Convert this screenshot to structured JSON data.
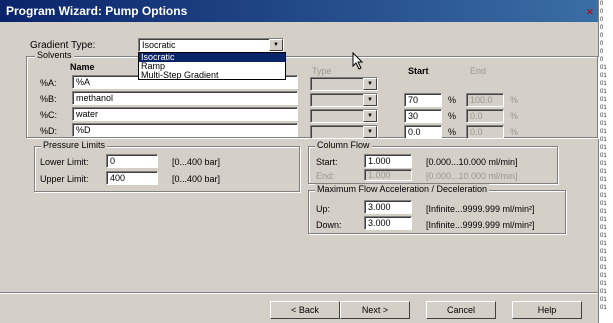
{
  "window": {
    "title": "Program Wizard: Pump Options"
  },
  "gradient": {
    "label": "Gradient Type:",
    "value": "Isocratic",
    "options": [
      "Isocratic",
      "Ramp",
      "Multi-Step Gradient"
    ]
  },
  "solvents": {
    "legend": "Solvents",
    "col_name": "Name",
    "col_type": "Type",
    "col_start": "Start",
    "col_end": "End",
    "percent_sign": "%",
    "rows": [
      {
        "label": "%A:",
        "name": "%A",
        "start": "",
        "end": ""
      },
      {
        "label": "%B:",
        "name": "methanol",
        "start": "70",
        "end": "100.0"
      },
      {
        "label": "%C:",
        "name": "water",
        "start": "30",
        "end": "0.0"
      },
      {
        "label": "%D:",
        "name": "%D",
        "start": "0.0",
        "end": "0.0"
      }
    ]
  },
  "pressure": {
    "legend": "Pressure Limits",
    "lower_label": "Lower Limit:",
    "lower_value": "0",
    "lower_range": "[0...400 bar]",
    "upper_label": "Upper Limit:",
    "upper_value": "400",
    "upper_range": "[0...400 bar]"
  },
  "column_flow": {
    "legend": "Column Flow",
    "start_label": "Start:",
    "start_value": "1.000",
    "start_range": "[0.000...10.000 ml/min]",
    "end_label": "End:",
    "end_value": "1.000",
    "end_range": "[0.000...10.000 ml/min]"
  },
  "max_flow": {
    "legend": "Maximum Flow Acceleration / Deceleration",
    "up_label": "Up:",
    "up_value": "3.000",
    "up_range": "[Infinite...9999.999 ml/min²]",
    "down_label": "Down:",
    "down_value": "3.000",
    "down_range": "[Infinite...9999.999 ml/min²]"
  },
  "buttons": {
    "back": "< Back",
    "next": "Next >",
    "cancel": "Cancel",
    "help": "Help"
  },
  "close_glyph": "×",
  "background_fragments": [
    "0",
    "0",
    "0",
    "0",
    "0",
    "0",
    "0",
    "0",
    "01",
    "01",
    "01",
    "01",
    "01",
    "01",
    "01",
    "01",
    "01",
    "01",
    "01",
    "01",
    "01",
    "01",
    "01",
    "01",
    "01",
    "01",
    "01",
    "01",
    "01",
    "01",
    "01",
    "01",
    "01",
    "01",
    "01",
    "01",
    "01",
    "01",
    "01"
  ],
  "colors": {
    "titlebar": "#0a246a",
    "face": "#d4d0c8",
    "selection": "#0a246a"
  }
}
